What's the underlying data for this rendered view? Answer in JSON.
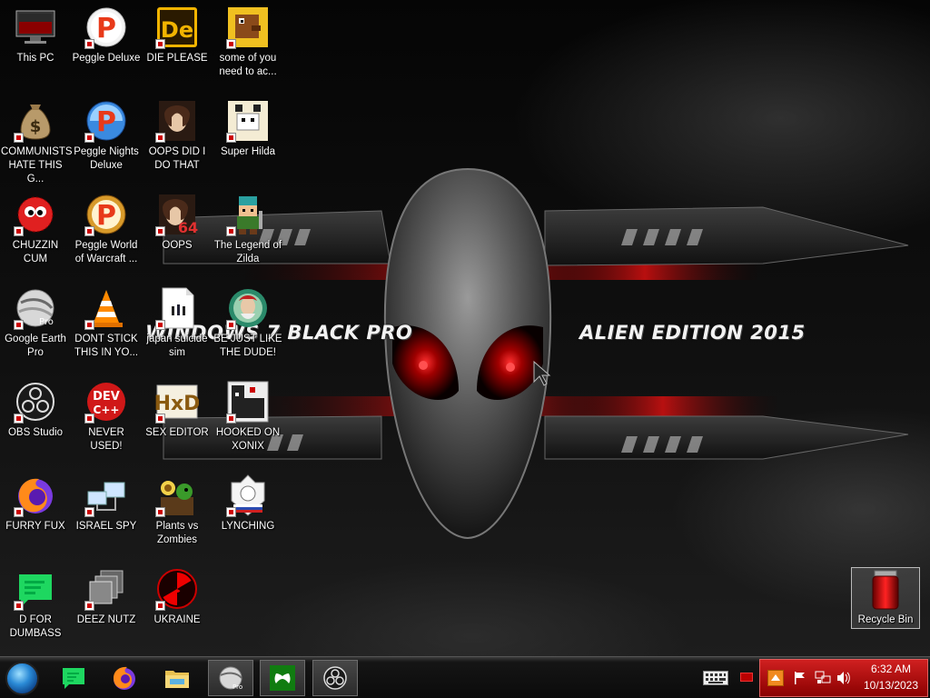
{
  "wallpaper": {
    "left_text": "WINDOWS 7 BLACK PRO",
    "right_text": "ALIEN EDITION 2015"
  },
  "desktop_icons": [
    {
      "label": "This PC",
      "icon": "monitor-icon"
    },
    {
      "label": "Peggle Deluxe",
      "icon": "peggle-icon"
    },
    {
      "label": "DIE PLEASE",
      "icon": "adobe-die-icon"
    },
    {
      "label": "some of you need to ac...",
      "icon": "pixel-dog-icon"
    },
    {
      "label": "COMMUNISTS HATE THIS G...",
      "icon": "money-bag-icon"
    },
    {
      "label": "Peggle Nights Deluxe",
      "icon": "peggle-nights-icon"
    },
    {
      "label": "OOPS DID I DO THAT",
      "icon": "portrait-icon"
    },
    {
      "label": "Super Hilda",
      "icon": "pixel-hilda-icon"
    },
    {
      "label": "CHUZZIN CUM",
      "icon": "chuzzle-icon"
    },
    {
      "label": "Peggle World of Warcraft ...",
      "icon": "peggle-wow-icon"
    },
    {
      "label": "OOPS",
      "icon": "portrait-64-icon"
    },
    {
      "label": "The Legend of Zilda",
      "icon": "pixel-hero-icon"
    },
    {
      "label": "Google Earth Pro",
      "icon": "google-earth-icon"
    },
    {
      "label": "DONT STICK THIS IN YO...",
      "icon": "vlc-cone-icon"
    },
    {
      "label": "japan suicide sim",
      "icon": "document-icon"
    },
    {
      "label": "BE JUST LIKE THE DUDE!",
      "icon": "dude-game-icon"
    },
    {
      "label": "OBS Studio",
      "icon": "obs-icon"
    },
    {
      "label": "NEVER USED!",
      "icon": "dev-cpp-icon"
    },
    {
      "label": "SEX EDITOR",
      "icon": "hxd-editor-icon"
    },
    {
      "label": "HOOKED ON XONIX",
      "icon": "xonix-icon"
    },
    {
      "label": "FURRY FUX",
      "icon": "firefox-icon"
    },
    {
      "label": "ISRAEL SPY",
      "icon": "network-computers-icon"
    },
    {
      "label": "Plants vs Zombies",
      "icon": "plants-icon"
    },
    {
      "label": "LYNCHING",
      "icon": "crest-icon"
    },
    {
      "label": "D FOR DUMBASS",
      "icon": "chat-bubble-icon"
    },
    {
      "label": "DEEZ NUTZ",
      "icon": "window-stack-icon"
    },
    {
      "label": "UKRAINE",
      "icon": "radiation-icon"
    }
  ],
  "recycle_bin": {
    "label": "Recycle Bin",
    "icon": "recycle-bin-icon"
  },
  "taskbar": {
    "start_icon": "start-orb-icon",
    "apps": [
      {
        "name": "chat-app",
        "icon": "chat-bubble-icon",
        "active": false
      },
      {
        "name": "firefox",
        "icon": "firefox-icon",
        "active": false
      },
      {
        "name": "file-explorer",
        "icon": "folder-icon",
        "active": false
      },
      {
        "name": "google-earth-pro",
        "icon": "google-earth-icon",
        "active": true
      },
      {
        "name": "xbox",
        "icon": "xbox-icon",
        "active": true
      },
      {
        "name": "obs-studio",
        "icon": "obs-icon",
        "active": true
      }
    ],
    "tray": {
      "time": "6:32 AM",
      "date": "10/13/2023"
    }
  },
  "colors": {
    "accent_red": "#c00000",
    "tray_red": "#b80000",
    "taskbar_bg": "#0b0b0b"
  }
}
